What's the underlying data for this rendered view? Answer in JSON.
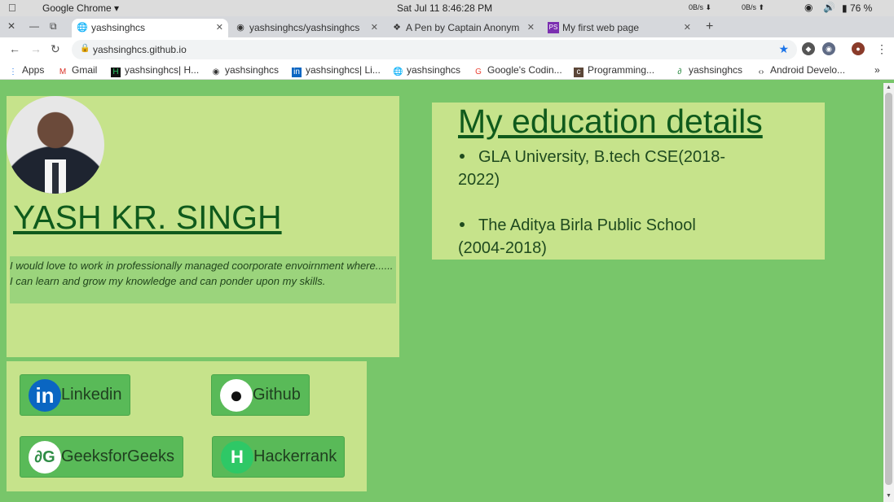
{
  "os": {
    "app_name": "Google Chrome ▾",
    "clock": "Sat Jul 11   8:46:28 PM",
    "net_down": "0B/s ⬇",
    "net_up": "0B/s ⬆",
    "battery": "76 %"
  },
  "tabs": [
    {
      "label": "yashsinghcs",
      "icon": "globe-icon",
      "active": true
    },
    {
      "label": "yashsinghcs/yashsinghcs",
      "icon": "github-icon"
    },
    {
      "label": "A Pen by Captain Anonym",
      "icon": "codepen-icon"
    },
    {
      "label": "My first web page",
      "icon": "phpstorm-icon"
    }
  ],
  "address": {
    "url": "yashsinghcs.github.io"
  },
  "bookmarks": [
    {
      "label": "Apps",
      "icon": "apps-grid-icon"
    },
    {
      "label": "Gmail",
      "icon": "gmail-icon"
    },
    {
      "label": "yashsinghcs| H...",
      "icon": "hackerrank-icon"
    },
    {
      "label": "yashsinghcs",
      "icon": "github-icon"
    },
    {
      "label": "yashsinghcs| Li...",
      "icon": "linkedin-icon"
    },
    {
      "label": "yashsinghcs",
      "icon": "globe-icon"
    },
    {
      "label": "Google's Codin...",
      "icon": "google-icon"
    },
    {
      "label": "Programming...",
      "icon": "codechef-icon"
    },
    {
      "label": "yashsinghcs",
      "icon": "gfg-icon"
    },
    {
      "label": "Android Develo...",
      "icon": "android-code-icon"
    }
  ],
  "profile": {
    "name": "YASH KR. SINGH",
    "quote_line1": "I would love to work in professionally managed coorporate envoirnment where......",
    "quote_line2": "I can learn and grow my knowledge and can ponder upon my skills."
  },
  "social": {
    "linkedin": "Linkedin",
    "github": "Github",
    "gfg": "GeeksforGeeks",
    "hackerrank": "Hackerrank"
  },
  "education": {
    "title": "My education details",
    "items": [
      "GLA University, B.tech CSE(2018-2022)",
      "The Aditya Birla Public School (2004-2018)"
    ]
  },
  "colors": {
    "page_bg": "#78c66a",
    "card_bg": "#c6e38b",
    "heading": "#0f5a1c",
    "button_bg": "#59ba58"
  }
}
